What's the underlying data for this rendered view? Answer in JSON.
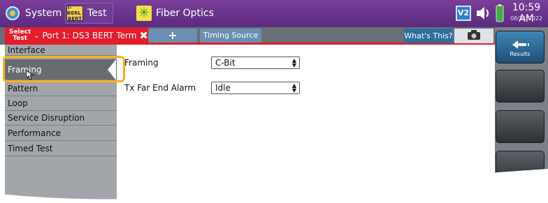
{
  "topbar": {
    "tabs": [
      {
        "label": "System",
        "icon": "gear-icon"
      },
      {
        "label": "Test",
        "icon": "bert-test-icon",
        "icon_text": [
          "T-BERL",
          "BERT"
        ]
      },
      {
        "label": "Fiber Optics",
        "icon": "fiber-optics-icon"
      }
    ],
    "status": {
      "v2_badge": "V2",
      "time": "10:59 AM",
      "date": "08/21/2022"
    }
  },
  "test_bar": {
    "select_test_label": "Select Test",
    "port_tab_label": "Port 1: DS3 BERT Term",
    "add_tab_label": "+",
    "timing_source_label": "Timing Source",
    "whats_this_label": "What's This?"
  },
  "right_rail": {
    "results_label": "Results"
  },
  "nav": {
    "items": [
      "Interface",
      "Framing",
      "Pattern",
      "Loop",
      "Service Disruption",
      "Performance",
      "Timed Test"
    ],
    "selected": "Framing"
  },
  "fields": {
    "framing": {
      "label": "Framing",
      "value": "C-Bit"
    },
    "tx_far_end_alarm": {
      "label": "Tx Far End Alarm",
      "value": "Idle"
    }
  },
  "colors": {
    "topbar": "#6a3590",
    "port_tab": "#e21d2c",
    "highlight": "#f6b21b",
    "results_button": "#2f6d9c"
  }
}
